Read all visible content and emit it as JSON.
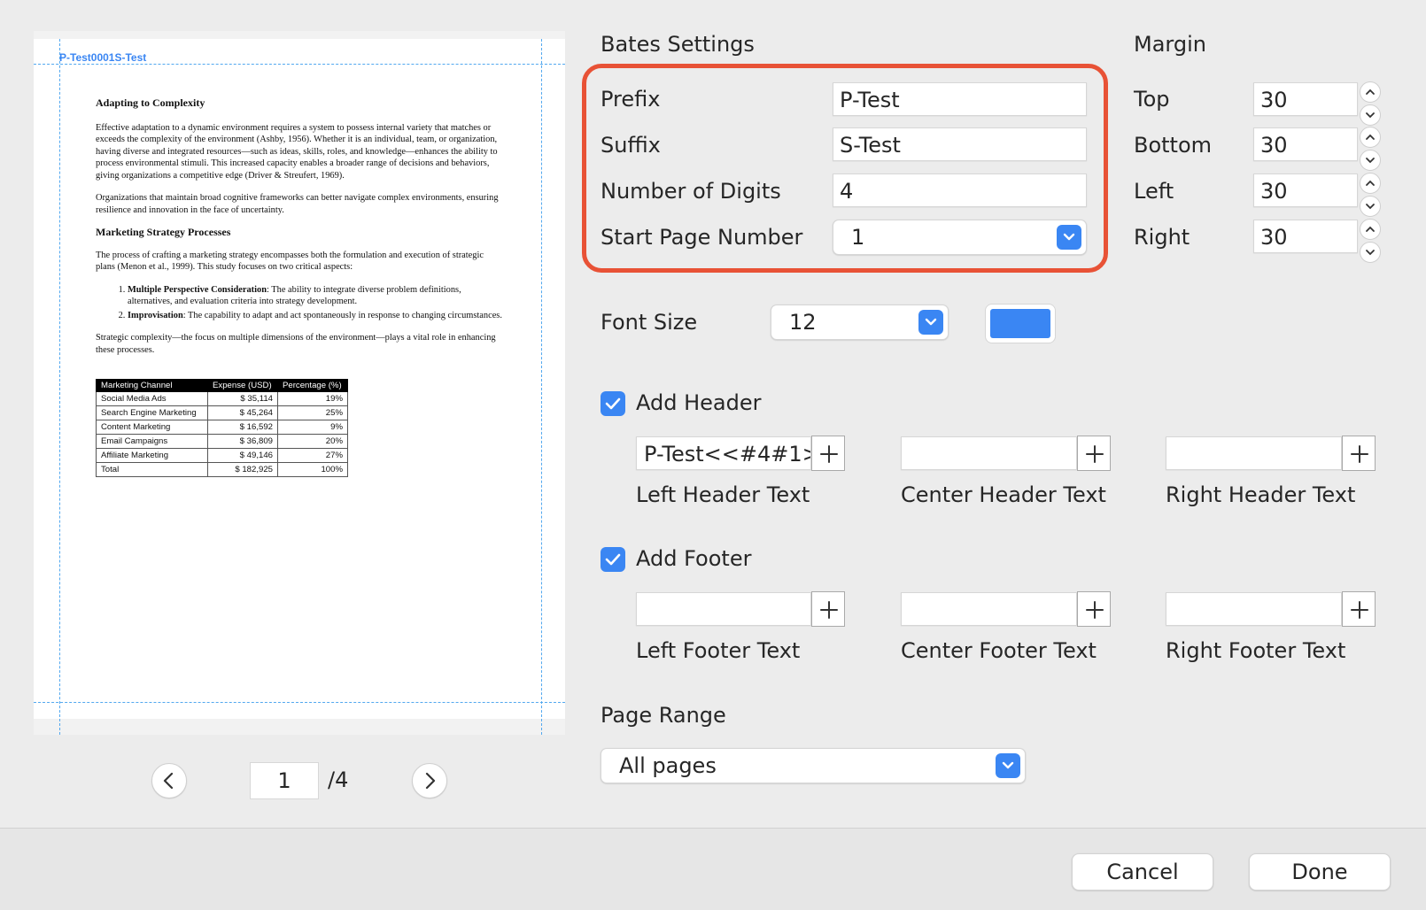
{
  "preview": {
    "bates_stamp": "P-Test0001S-Test",
    "document": {
      "heading1": "Adapting to Complexity",
      "para1": "Effective adaptation to a dynamic environment requires a system to possess internal variety that matches or exceeds the complexity of the environment (Ashby, 1956). Whether it is an individual, team, or organization, having diverse and integrated resources—such as ideas, skills, roles, and knowledge—enhances the ability to process environmental stimuli. This increased capacity enables a broader range of decisions and behaviors, giving organizations a competitive edge (Driver & Streufert, 1969).",
      "para2": "Organizations that maintain broad cognitive frameworks can better navigate complex environments, ensuring resilience and innovation in the face of uncertainty.",
      "heading2": "Marketing Strategy Processes",
      "para3": "The process of crafting a marketing strategy encompasses both the formulation and execution of strategic plans (Menon et al., 1999). This study focuses on two critical aspects:",
      "list": [
        {
          "bold": "Multiple Perspective Consideration",
          "text": ": The ability to integrate diverse problem definitions, alternatives, and evaluation criteria into strategy development."
        },
        {
          "bold": "Improvisation",
          "text": ": The capability to adapt and act spontaneously in response to changing circumstances."
        }
      ],
      "para4": "Strategic complexity—the focus on multiple dimensions of the environment—plays a vital role in enhancing these processes.",
      "table": {
        "headers": [
          "Marketing Channel",
          "Expense (USD)",
          "Percentage (%)"
        ],
        "rows": [
          [
            "Social Media Ads",
            "$ 35,114",
            "19%"
          ],
          [
            "Search Engine Marketing",
            "$ 45,264",
            "25%"
          ],
          [
            "Content Marketing",
            "$ 16,592",
            "9%"
          ],
          [
            "Email Campaigns",
            "$ 36,809",
            "20%"
          ],
          [
            "Affiliate Marketing",
            "$ 49,146",
            "27%"
          ],
          [
            "Total",
            "$ 182,925",
            "100%"
          ]
        ]
      }
    }
  },
  "pager": {
    "current_page": "1",
    "total": "/4"
  },
  "bates": {
    "section_title": "Bates Settings",
    "prefix_label": "Prefix",
    "prefix_value": "P-Test",
    "suffix_label": "Suffix",
    "suffix_value": "S-Test",
    "digits_label": "Number of Digits",
    "digits_value": "4",
    "start_label": "Start Page Number",
    "start_value": "1"
  },
  "margin": {
    "section_title": "Margin",
    "top_label": "Top",
    "top_value": "30",
    "bottom_label": "Bottom",
    "bottom_value": "30",
    "left_label": "Left",
    "left_value": "30",
    "right_label": "Right",
    "right_value": "30"
  },
  "font": {
    "label": "Font Size",
    "value": "12",
    "color": "#3a86f3"
  },
  "header": {
    "checkbox_label": "Add Header",
    "checked": true,
    "left_value": "P-Test<<#4#1>",
    "center_value": "",
    "right_value": "",
    "left_label": "Left Header Text",
    "center_label": "Center Header Text",
    "right_label": "Right Header Text"
  },
  "footer": {
    "checkbox_label": "Add Footer",
    "checked": true,
    "left_value": "",
    "center_value": "",
    "right_value": "",
    "left_label": "Left Footer Text",
    "center_label": "Center Footer Text",
    "right_label": "Right Footer Text"
  },
  "page_range": {
    "label": "Page Range",
    "value": "All pages"
  },
  "actions": {
    "cancel": "Cancel",
    "done": "Done"
  },
  "colors": {
    "accent": "#3a86f3",
    "highlight": "#e85236",
    "guide": "#52a8ef"
  },
  "icons": [
    "chevron-left-icon",
    "chevron-right-icon",
    "chevron-down-icon",
    "chevron-up-icon",
    "plus-icon",
    "checkmark-icon"
  ]
}
